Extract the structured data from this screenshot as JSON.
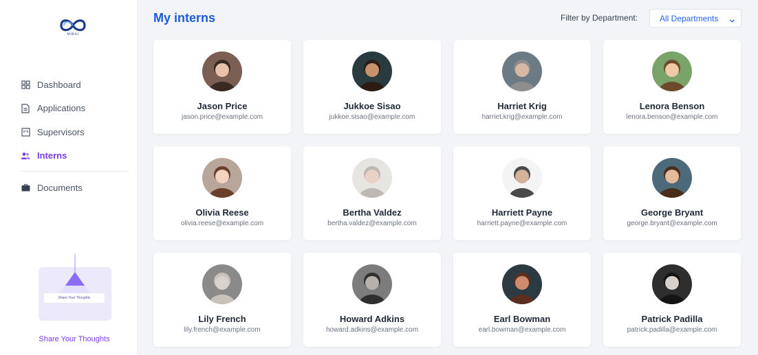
{
  "brand": {
    "logo_text": "MIRAI",
    "logo_color": "#1e3a8a"
  },
  "sidebar": {
    "items": [
      {
        "label": "Dashboard",
        "icon": "grid-icon",
        "active": false
      },
      {
        "label": "Applications",
        "icon": "document-icon",
        "active": false
      },
      {
        "label": "Supervisors",
        "icon": "board-icon",
        "active": false
      },
      {
        "label": "Interns",
        "icon": "users-icon",
        "active": true
      }
    ],
    "secondary": [
      {
        "label": "Documents",
        "icon": "briefcase-icon",
        "active": false
      }
    ],
    "promo": {
      "button_label": "Share Your Thoughts",
      "link_label": "Share Your Thoughts",
      "illustration": "lamp-icon"
    }
  },
  "header": {
    "title": "My interns",
    "filter_label": "Filter by Department:",
    "filter_value": "All Departments"
  },
  "colors": {
    "accent": "#7c3aed",
    "title": "#1e5bd8",
    "link": "#2563eb"
  },
  "interns": [
    {
      "name": "Jason Price",
      "email": "jason.price@example.com",
      "avatar_bg": "#7b5f52",
      "avatar_skin": "#e7c2a8",
      "avatar_hair": "#3b2a22"
    },
    {
      "name": "Jukkoe Sisao",
      "email": "jukkoe.sisao@example.com",
      "avatar_bg": "#2a3b40",
      "avatar_skin": "#c9926e",
      "avatar_hair": "#2b1c14"
    },
    {
      "name": "Harriet Krig",
      "email": "harriet.krig@example.com",
      "avatar_bg": "#6c7a83",
      "avatar_skin": "#d9b8a3",
      "avatar_hair": "#8e8e8e"
    },
    {
      "name": "Lenora Benson",
      "email": "lenora.benson@example.com",
      "avatar_bg": "#7aa36a",
      "avatar_skin": "#f0c9a7",
      "avatar_hair": "#6d4a2c"
    },
    {
      "name": "Olivia Reese",
      "email": "olivia.reese@example.com",
      "avatar_bg": "#b8a69b",
      "avatar_skin": "#f2d3c0",
      "avatar_hair": "#6a3f2c"
    },
    {
      "name": "Bertha Valdez",
      "email": "bertha.valdez@example.com",
      "avatar_bg": "#e7e5e2",
      "avatar_skin": "#e9d2c4",
      "avatar_hair": "#bdb8b3"
    },
    {
      "name": "Harriett Payne",
      "email": "harriett.payne@example.com",
      "avatar_bg": "#f4f4f4",
      "avatar_skin": "#d4b39c",
      "avatar_hair": "#4a4a4a"
    },
    {
      "name": "George Bryant",
      "email": "george.bryant@example.com",
      "avatar_bg": "#4d6a7a",
      "avatar_skin": "#e5bb9b",
      "avatar_hair": "#4a2e1c"
    },
    {
      "name": "Lily French",
      "email": "lily.french@example.com",
      "avatar_bg": "#8a8a8a",
      "avatar_skin": "#d9d2cc",
      "avatar_hair": "#c8c2bb"
    },
    {
      "name": "Howard Adkins",
      "email": "howard.adkins@example.com",
      "avatar_bg": "#7c7c7c",
      "avatar_skin": "#b7b1ad",
      "avatar_hair": "#2f2f2f"
    },
    {
      "name": "Earl Bowman",
      "email": "earl.bowman@example.com",
      "avatar_bg": "#2c3a44",
      "avatar_skin": "#cc8b6a",
      "avatar_hair": "#5a2f1e"
    },
    {
      "name": "Patrick Padilla",
      "email": "patrick.padilla@example.com",
      "avatar_bg": "#2e2e2e",
      "avatar_skin": "#d7d0cb",
      "avatar_hair": "#151515"
    }
  ]
}
